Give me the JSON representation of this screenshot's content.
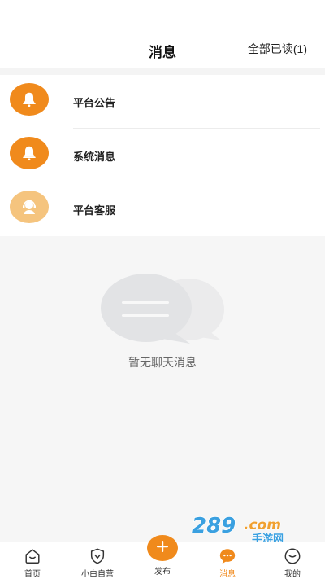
{
  "header": {
    "title": "消息",
    "read_all_label": "全部已读(1)"
  },
  "messages": [
    {
      "label": "平台公告",
      "icon": "bell-icon",
      "color": "#f08a1c"
    },
    {
      "label": "系统消息",
      "icon": "bell-icon",
      "color": "#f08a1c"
    },
    {
      "label": "平台客服",
      "icon": "support-agent-icon",
      "color": "#f5c47e"
    }
  ],
  "empty_state": {
    "text": "暂无聊天消息",
    "icon": "chat-bubbles-icon"
  },
  "watermark": {
    "text": "289.com 手游网"
  },
  "tabbar": {
    "items": [
      {
        "label": "首页",
        "icon": "home-icon"
      },
      {
        "label": "小白自营",
        "icon": "shield-play-icon"
      },
      {
        "label": "发布",
        "icon": "plus-icon"
      },
      {
        "label": "消息",
        "icon": "chat-icon",
        "active": true
      },
      {
        "label": "我的",
        "icon": "smile-icon"
      }
    ]
  },
  "colors": {
    "accent": "#f08a1c",
    "accent_light": "#f5c47e"
  }
}
